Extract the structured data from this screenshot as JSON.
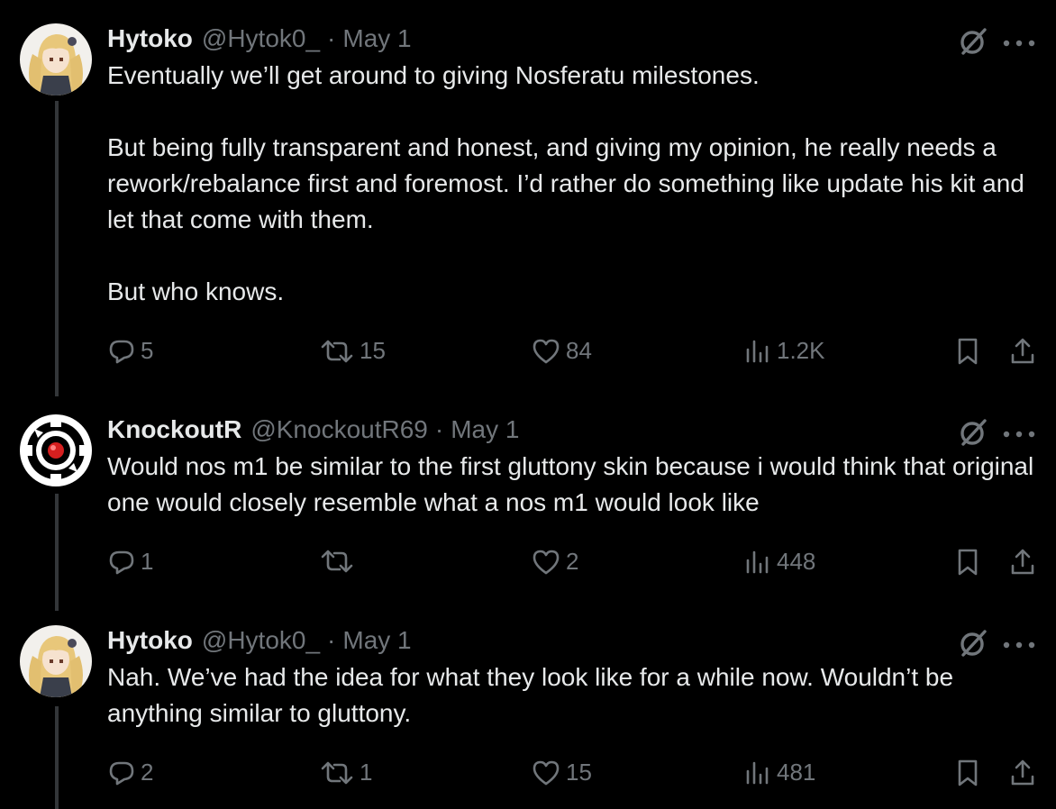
{
  "tweets": [
    {
      "name": "Hytoko",
      "handle": "@Hytok0_",
      "separator": "·",
      "date": "May 1",
      "text": "Eventually we’ll get around to giving Nosferatu milestones.\n\nBut being fully transparent and honest, and giving my opinion, he really needs a rework/rebalance first and foremost. I’d rather do something like update his kit and let that come with them.\n\nBut who knows.",
      "replies": "5",
      "reposts": "15",
      "likes": "84",
      "views": "1.2K"
    },
    {
      "name": "KnockoutR",
      "handle": "@KnockoutR69",
      "separator": "·",
      "date": "May 1",
      "text": "Would nos m1 be similar to the first gluttony skin because i would think that original one would closely resemble what a nos m1 would look like",
      "replies": "1",
      "reposts": "",
      "likes": "2",
      "views": "448"
    },
    {
      "name": "Hytoko",
      "handle": "@Hytok0_",
      "separator": "·",
      "date": "May 1",
      "text": "Nah. We’ve had the idea for what they look like for a while now. Wouldn’t be anything similar to gluttony.",
      "replies": "2",
      "reposts": "1",
      "likes": "15",
      "views": "481"
    }
  ],
  "colors": {
    "background": "#000000",
    "text": "#e7e9ea",
    "secondary": "#71767b",
    "thread_line": "#333639"
  }
}
